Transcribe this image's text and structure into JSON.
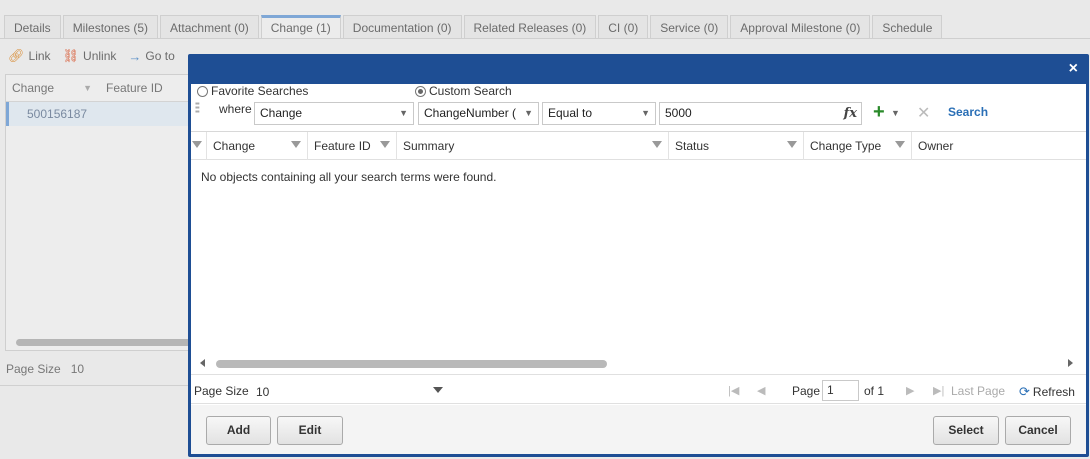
{
  "tabs": [
    "Details",
    "Milestones (5)",
    "Attachment (0)",
    "Change (1)",
    "Documentation (0)",
    "Related Releases (0)",
    "CI (0)",
    "Service (0)",
    "Approval Milestone (0)",
    "Schedule"
  ],
  "toolbar": {
    "link": "Link",
    "unlink": "Unlink",
    "goto": "Go to"
  },
  "bg_grid": {
    "col1": "Change",
    "col2": "Feature ID",
    "row_value": "500156187"
  },
  "bg_pager": {
    "label": "Page Size",
    "value": "10"
  },
  "modal": {
    "close": "×",
    "favorite_searches": "Favorite Searches",
    "custom_search": "Custom Search",
    "where": "where",
    "field1": "Change",
    "field2": "ChangeNumber (",
    "operator": "Equal to",
    "value": "5000",
    "fx": "fx",
    "search": "Search",
    "columns": [
      "Change",
      "Feature ID",
      "Summary",
      "Status",
      "Change Type",
      "Owner"
    ],
    "empty_message": "No objects containing all your search terms were found.",
    "page_size_label": "Page Size",
    "page_size_value": "10",
    "page_label": "Page",
    "page_value": "1",
    "of_label": "of 1",
    "last_page": "Last Page",
    "refresh": "Refresh",
    "buttons": {
      "add": "Add",
      "edit": "Edit",
      "select": "Select",
      "cancel": "Cancel"
    }
  }
}
